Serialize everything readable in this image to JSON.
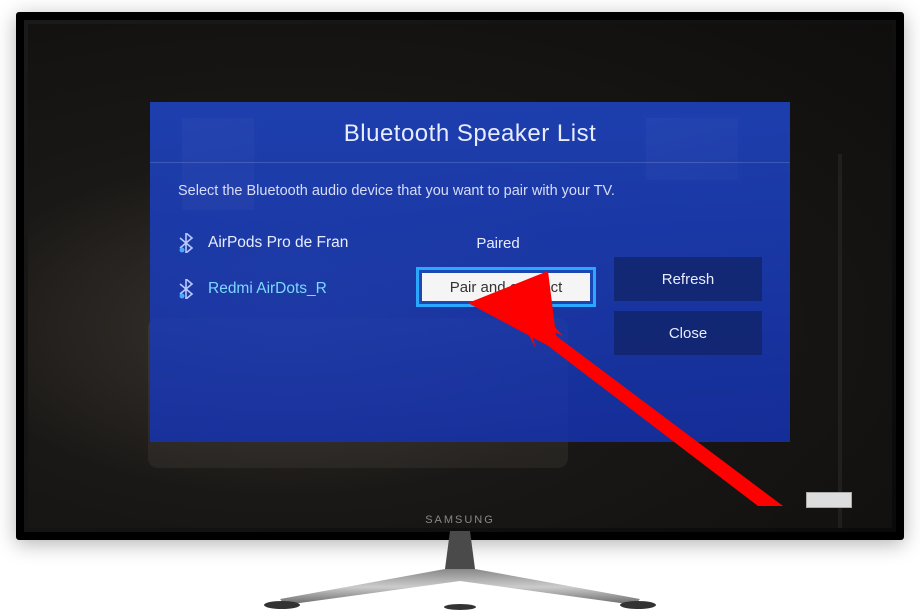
{
  "tv": {
    "brand": "SAMSUNG"
  },
  "panel": {
    "title": "Bluetooth Speaker List",
    "instruction": "Select the Bluetooth audio device that you want to pair with your TV.",
    "devices": [
      {
        "name": "AirPods Pro de Fran",
        "status": "Paired",
        "selected": false
      },
      {
        "name": "Redmi AirDots_R",
        "status": "",
        "selected": true
      }
    ],
    "pair_connect_label": "Pair and connect",
    "buttons": {
      "refresh": "Refresh",
      "close": "Close"
    }
  }
}
